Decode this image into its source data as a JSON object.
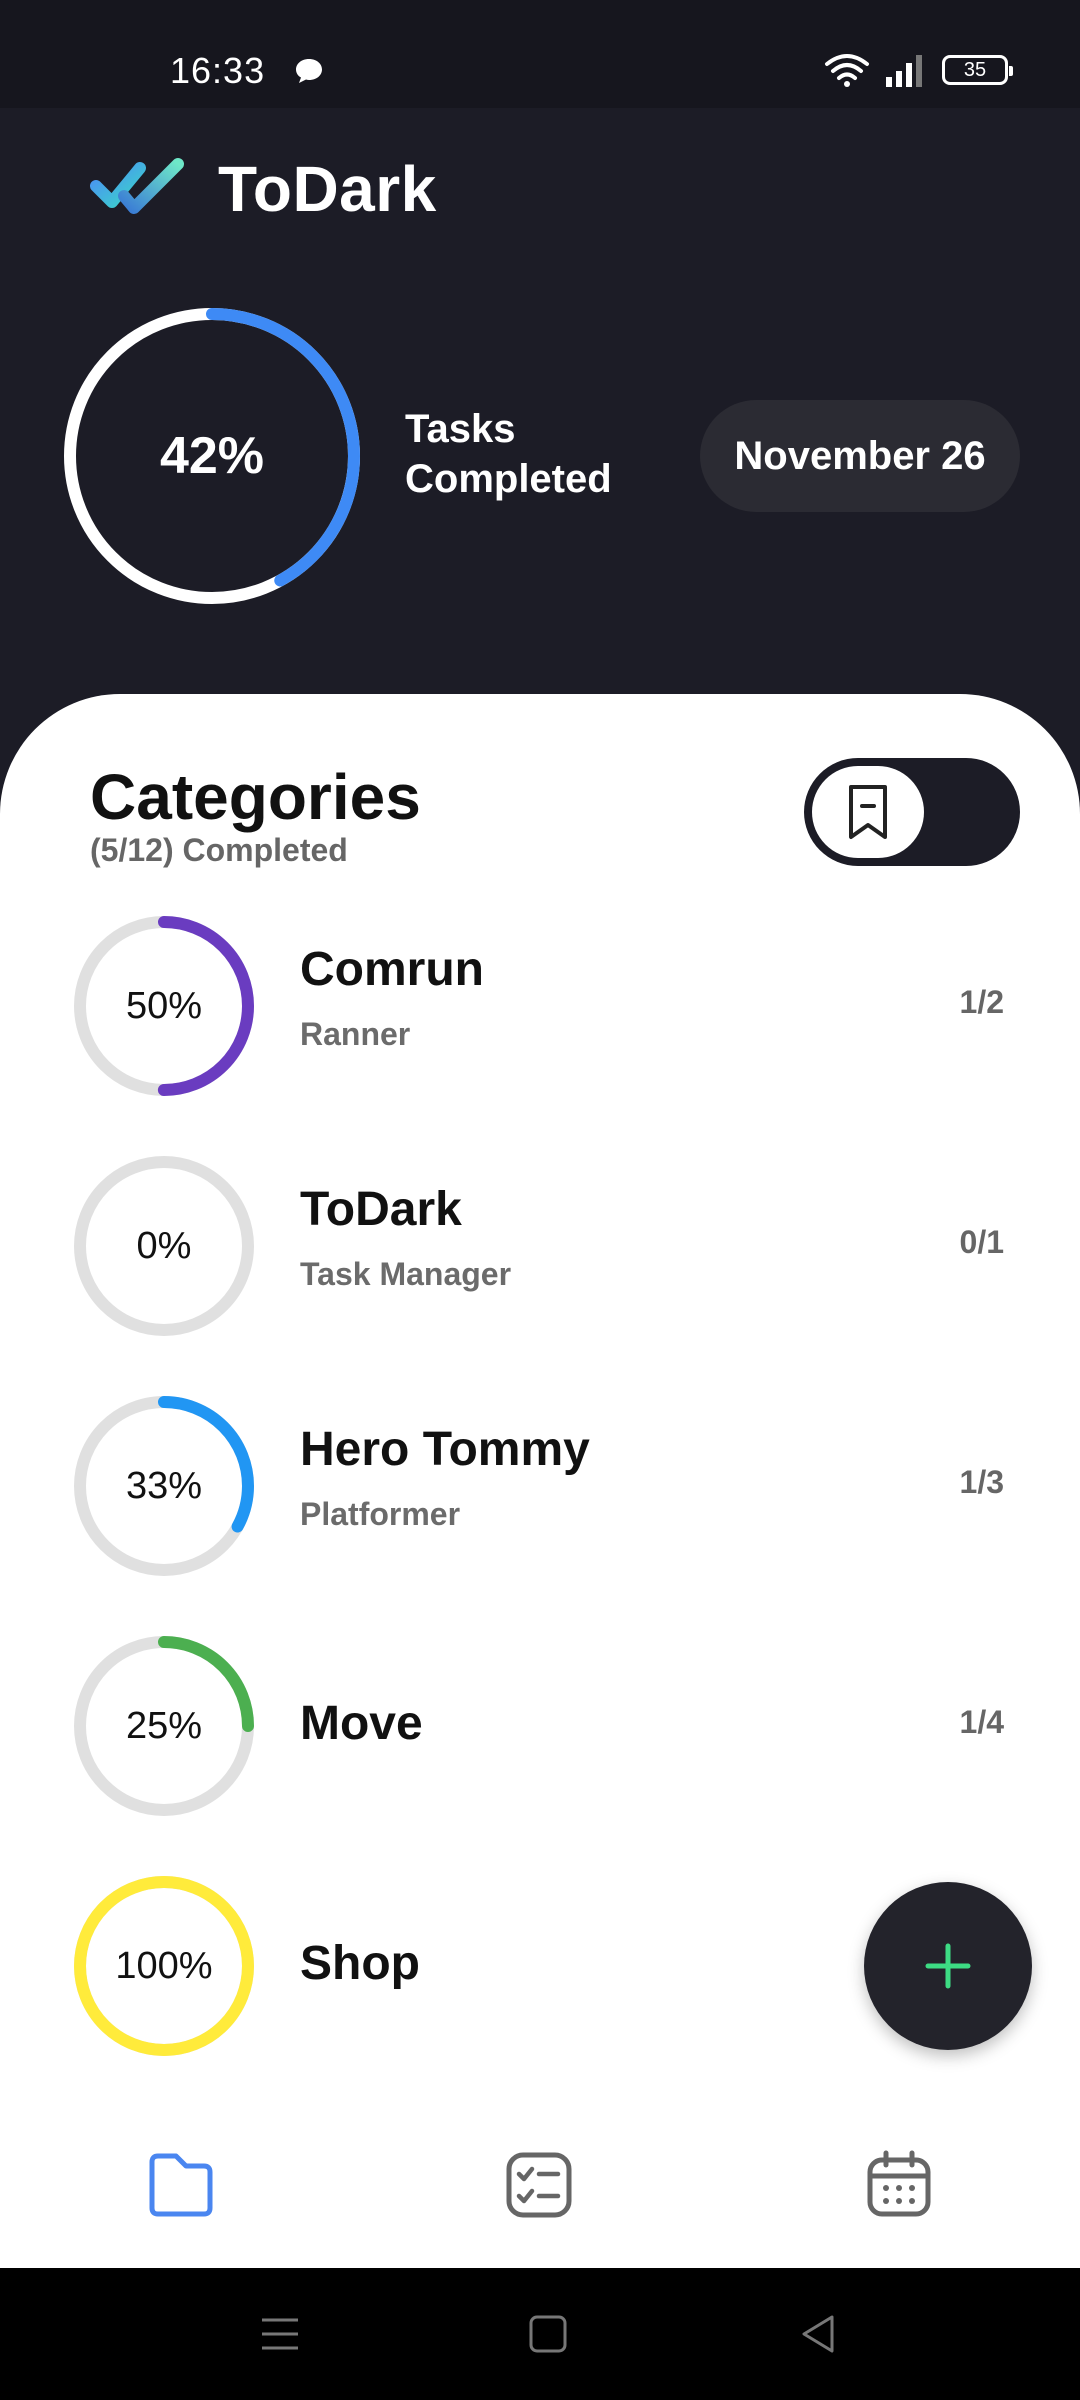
{
  "status_bar": {
    "time": "16:33",
    "battery": "35",
    "icons": [
      "chat-bubble-icon",
      "wifi-icon",
      "signal-icon",
      "battery-icon"
    ]
  },
  "header": {
    "app_name": "ToDark",
    "overall_percent_label": "42%",
    "overall_progress": 0.42,
    "tasks_completed_label": "Tasks Completed",
    "date": "November 26",
    "accent_color": "#3e8af5"
  },
  "categories": {
    "title": "Categories",
    "subtitle": "(5/12) Completed",
    "items": [
      {
        "name": "Comrun",
        "description": "Ranner",
        "percent_label": "50%",
        "progress": 0.5,
        "count": "1/2",
        "color": "#6a3cc0"
      },
      {
        "name": "ToDark",
        "description": "Task Manager",
        "percent_label": "0%",
        "progress": 0,
        "count": "0/1",
        "color": "#3e8af5"
      },
      {
        "name": "Hero Tommy",
        "description": "Platformer",
        "percent_label": "33%",
        "progress": 0.33,
        "count": "1/3",
        "color": "#2196f3"
      },
      {
        "name": "Move",
        "description": "",
        "percent_label": "25%",
        "progress": 0.25,
        "count": "1/4",
        "color": "#4caf50"
      },
      {
        "name": "Shop",
        "description": "",
        "percent_label": "100%",
        "progress": 1.0,
        "count": "",
        "color": "#ffeb3b"
      }
    ]
  },
  "fab": {
    "icon": "plus-icon",
    "color": "#3ddc84"
  },
  "bottom_nav": {
    "items": [
      {
        "icon": "folder-icon",
        "active": true
      },
      {
        "icon": "checklist-icon",
        "active": false
      },
      {
        "icon": "calendar-icon",
        "active": false
      }
    ],
    "active_color": "#4a86f0",
    "inactive_color": "#666666"
  },
  "system_nav": {
    "icons": [
      "menu-icon",
      "home-icon",
      "back-icon"
    ]
  }
}
